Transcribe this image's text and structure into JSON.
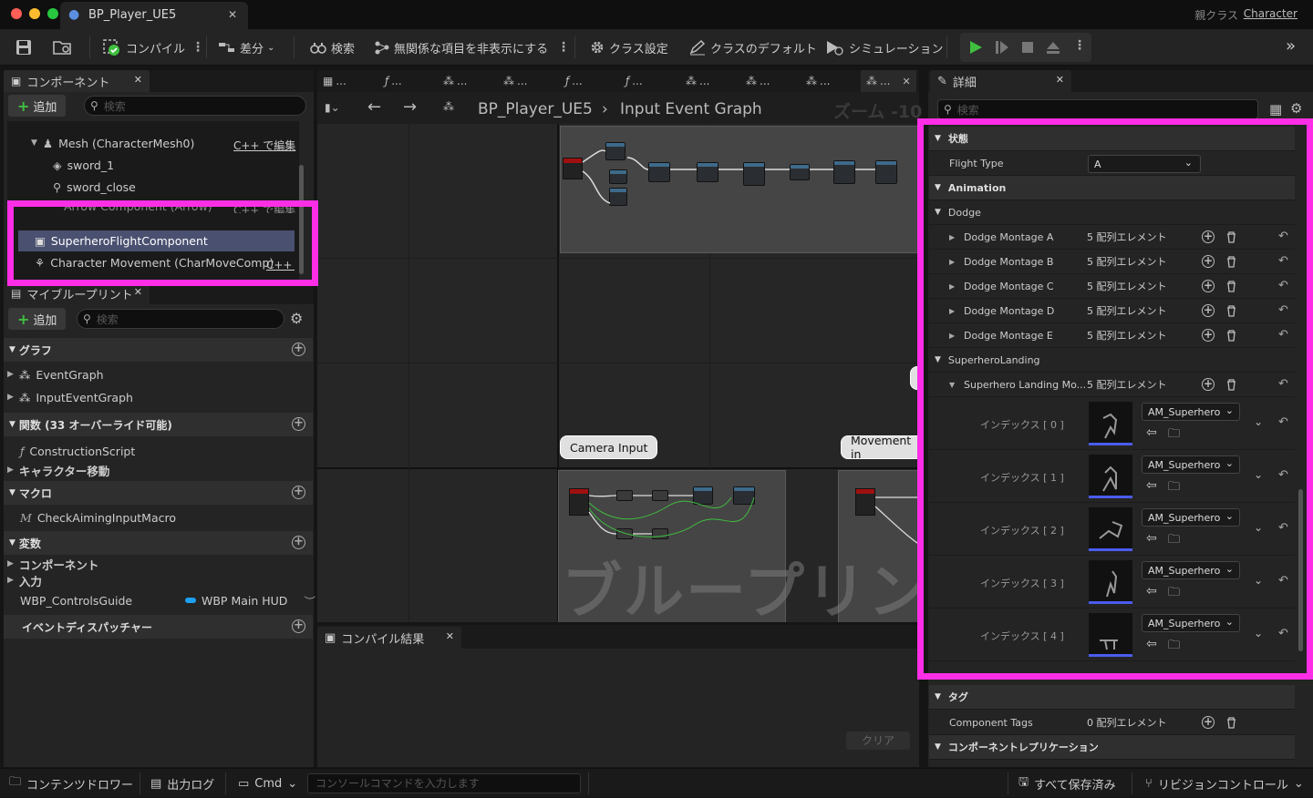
{
  "window": {
    "tab_title": "BP_Player_UE5",
    "parent_class_label": "親クラス",
    "parent_class_value": "Character"
  },
  "toolbar": {
    "compile": "コンパイル",
    "diff": "差分",
    "search": "検索",
    "hide_unrelated": "無関係な項目を非表示にする",
    "class_settings": "クラス設定",
    "class_defaults": "クラスのデフォルト",
    "simulation": "シミュレーション"
  },
  "components": {
    "tab_title": "コンポーネント",
    "add_label": "追加",
    "search_placeholder": "検索",
    "items": [
      {
        "label": "Mesh (CharacterMesh0)",
        "edit": "C++ で編集"
      },
      {
        "label": "sword_1"
      },
      {
        "label": "sword_close"
      },
      {
        "label": "Arrow Component (Arrow)",
        "edit": "C++ で編集"
      },
      {
        "label": "SuperheroFlightComponent"
      },
      {
        "label": "Character Movement (CharMoveComp)",
        "edit": "C++ で"
      }
    ]
  },
  "my_blueprint": {
    "tab_title": "マイブループリント",
    "add_label": "追加",
    "search_placeholder": "検索",
    "graphs_header": "グラフ",
    "graphs": [
      "EventGraph",
      "InputEventGraph"
    ],
    "functions_header": "関数 (33 オーバーライド可能)",
    "functions": [
      "ConstructionScript",
      "キャラクター移動"
    ],
    "macros_header": "マクロ",
    "macros": [
      "CheckAimingInputMacro"
    ],
    "variables_header": "変数",
    "variables": [
      "コンポーネント",
      "入力"
    ],
    "variable_item": {
      "name": "WBP_ControlsGuide",
      "type": "WBP Main HUD"
    },
    "dispatchers_header": "イベントディスパッチャー"
  },
  "graph": {
    "breadcrumb_root": "BP_Player_UE5",
    "breadcrumb_graph": "Input Event Graph",
    "zoom": "ズーム -10",
    "comment_camera": "Camera Input",
    "comment_movement": "Movement in",
    "watermark": "ブループリント",
    "tab_ellipsis": "..."
  },
  "compile_results": {
    "tab_title": "コンパイル結果",
    "clear_label": "クリア"
  },
  "details": {
    "tab_title": "詳細",
    "search_placeholder": "検索",
    "state_header": "状態",
    "flight_type_label": "Flight Type",
    "flight_type_value": "A",
    "animation_header": "Animation",
    "dodge_header": "Dodge",
    "dodge_rows": [
      {
        "label": "Dodge Montage A",
        "value": "5 配列エレメント"
      },
      {
        "label": "Dodge Montage B",
        "value": "5 配列エレメント"
      },
      {
        "label": "Dodge Montage C",
        "value": "5 配列エレメント"
      },
      {
        "label": "Dodge Montage D",
        "value": "5 配列エレメント"
      },
      {
        "label": "Dodge Montage E",
        "value": "5 配列エレメント"
      }
    ],
    "landing_header": "SuperheroLanding",
    "landing_label": "Superhero Landing Mo...",
    "landing_value": "5 配列エレメント",
    "indices": [
      {
        "label": "インデックス [ 0 ]",
        "asset": "AM_Superhero"
      },
      {
        "label": "インデックス [ 1 ]",
        "asset": "AM_Superhero"
      },
      {
        "label": "インデックス [ 2 ]",
        "asset": "AM_Superhero"
      },
      {
        "label": "インデックス [ 3 ]",
        "asset": "AM_Superhero"
      },
      {
        "label": "インデックス [ 4 ]",
        "asset": "AM_Superhero"
      }
    ],
    "tags_header": "タグ",
    "component_tags_label": "Component Tags",
    "component_tags_value": "0 配列エレメント",
    "replication_header": "コンポーネントレプリケーション"
  },
  "statusbar": {
    "content_drawer": "コンテンツドロワー",
    "output_log": "出力ログ",
    "cmd": "Cmd",
    "console_placeholder": "コンソールコマンドを入力します",
    "save_all": "すべて保存済み",
    "revision_control": "リビジョンコントロール"
  },
  "colors": {
    "highlight": "#ff2ee6",
    "accent_green": "#3fbf3f",
    "selection": "#4a5070"
  }
}
